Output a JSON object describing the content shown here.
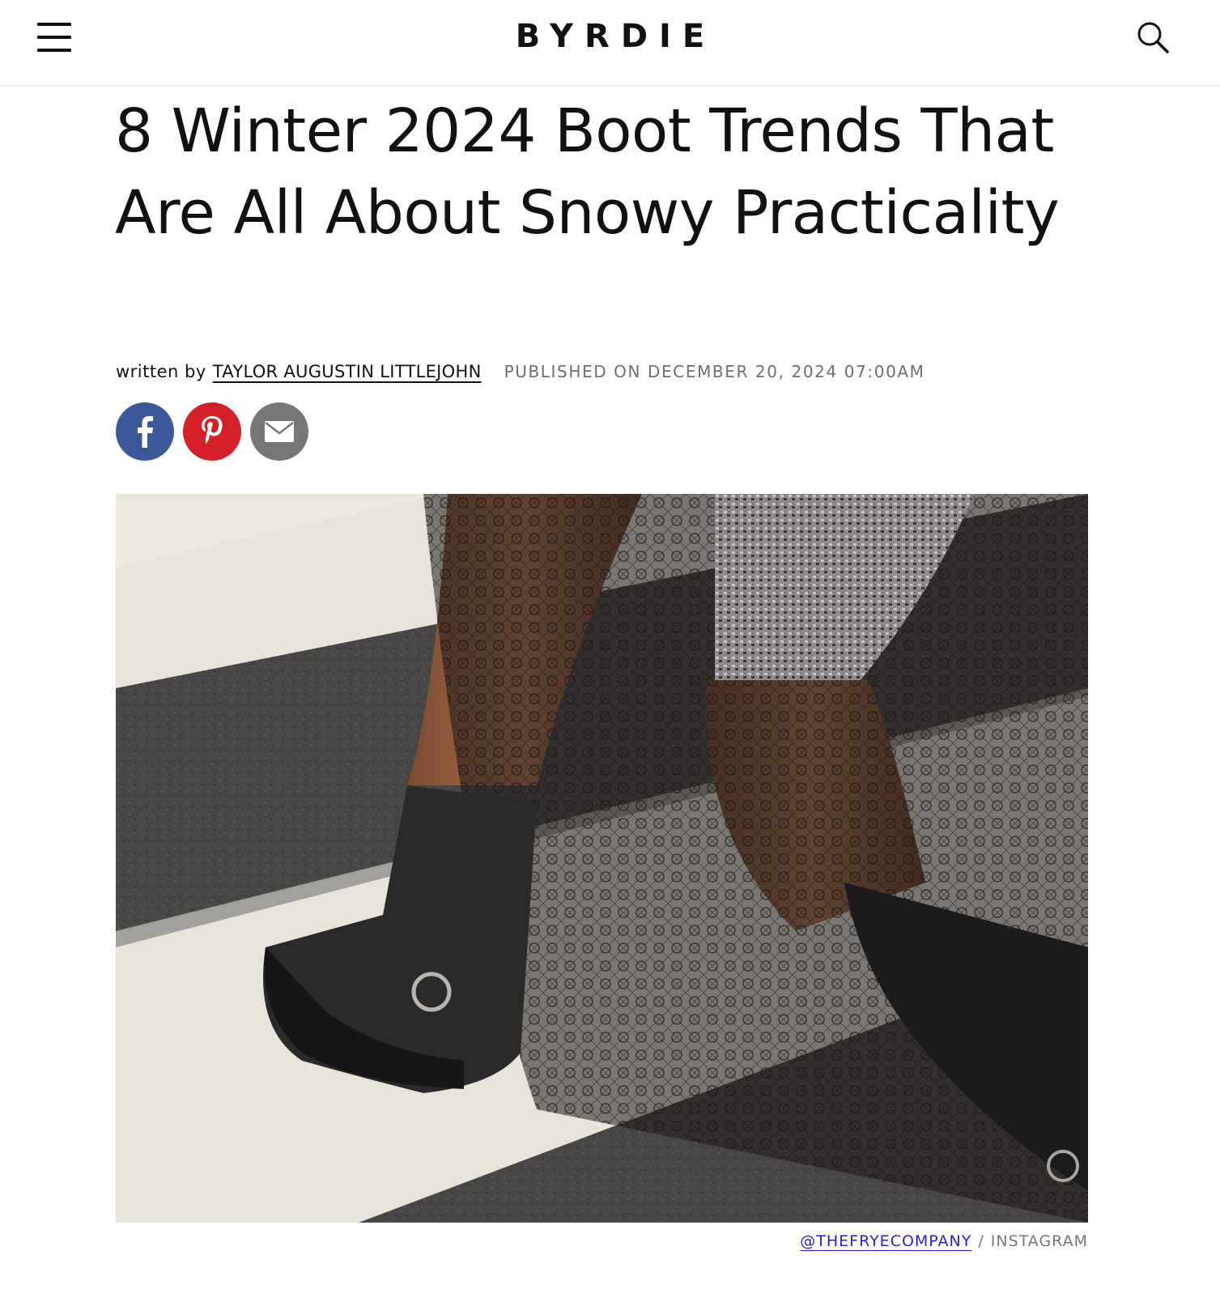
{
  "header": {
    "logo": "BYRDIE",
    "menu_icon": "hamburger-menu-icon",
    "search_icon": "search-icon"
  },
  "article": {
    "title": "8 Winter 2024 Boot Trends That Are All About Snowy Practicality",
    "written_by_label": "written by",
    "author": "TAYLOR AUGUSTIN LITTLEJOHN",
    "published": "PUBLISHED ON DECEMBER 20, 2024 07:00AM"
  },
  "share": {
    "buttons": [
      {
        "name": "facebook",
        "icon": "facebook-icon",
        "color": "#3b5998"
      },
      {
        "name": "pinterest",
        "icon": "pinterest-icon",
        "color": "#d42027"
      },
      {
        "name": "email",
        "icon": "email-icon",
        "color": "#777777"
      }
    ]
  },
  "hero_image": {
    "credit_handle": "@THEFRYECOMPANY",
    "credit_separator": "/",
    "credit_source": "INSTAGRAM"
  },
  "colors": {
    "link_accent": "#2d1ed6",
    "meta_gray": "#6e6e6e"
  }
}
